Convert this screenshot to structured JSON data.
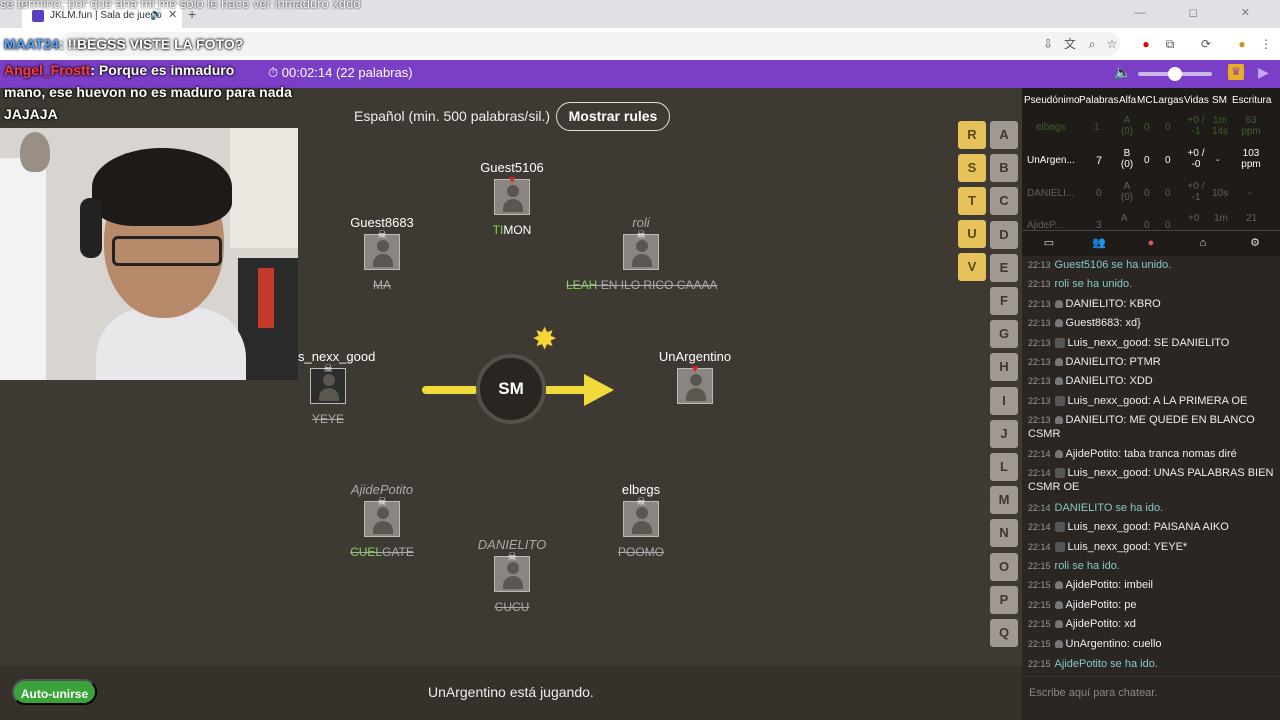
{
  "browser": {
    "tab_title": "JKLM.fun | Sala de juego",
    "controls": "— ◻ ✕"
  },
  "overlay": {
    "top_text": "se termino, por que ana mi me solo le hace ver inmaduro xddd",
    "line1_user": "MAAT24",
    "line1_text": ": !!BEGSS VISTE LA FOTO?",
    "line2_user": "Angel_Frostt",
    "line2_text": ": Porque es inmaduro",
    "line3": "mano, ese huevon no es maduro para nada",
    "line4": "JAJAJA"
  },
  "header": {
    "timer": "⏱ 00:02:14 (22 palabras)"
  },
  "game": {
    "language_label": "Español (min. 500 palabras/sil.)",
    "rules_button": "Mostrar rules",
    "bomb_syllable": "SM",
    "players": [
      {
        "name": "Guest5106",
        "word_green": "TI",
        "word_rest": "MON",
        "status": "alive"
      },
      {
        "name": "Guest8683",
        "word_green": "",
        "word_rest": "MA",
        "status": "dead"
      },
      {
        "name": "roli",
        "word_green": "LEAH",
        "word_rest": " EN ILO RICO CAAAA",
        "status": "dead"
      },
      {
        "name": "Luis_nexx_good",
        "word_green": "",
        "word_rest": "YEYE",
        "status": "dead"
      },
      {
        "name": "UnArgentino",
        "word_green": "",
        "word_rest": "",
        "status": "alive"
      },
      {
        "name": "AjidePotito",
        "word_green": "CUEL",
        "word_rest": "GATE",
        "status": "dead"
      },
      {
        "name": "elbegs",
        "word_green": "",
        "word_rest": "POOMO",
        "status": "dead"
      },
      {
        "name": "DANIELITO",
        "word_green": "",
        "word_rest": "CUCU",
        "status": "dead"
      }
    ],
    "letters_used": [
      "R",
      "S",
      "T",
      "U",
      "V"
    ],
    "letters_open": [
      "A",
      "B",
      "C",
      "D",
      "E",
      "F",
      "G",
      "H",
      "I",
      "J",
      "L",
      "M",
      "N",
      "O",
      "P",
      "Q"
    ],
    "auto_join": "Auto-unirse",
    "status": "UnArgentino está jugando."
  },
  "scoreboard": {
    "headers": [
      "Pseudónimo",
      "Palabras",
      "Alfa",
      "MC",
      "Largas",
      "Vidas",
      "SM",
      "Escritura"
    ],
    "rows": [
      {
        "name": "elbegs",
        "words": "1",
        "alfa": "A (0)",
        "mc": "0",
        "largas": "0",
        "vidas": "+0 / -1",
        "sm": "1m 14s",
        "speed": "63 ppm"
      },
      {
        "name": "UnArgen...",
        "words": "7",
        "alfa": "B (0)",
        "mc": "0",
        "largas": "0",
        "vidas": "+0 / -0",
        "sm": "-",
        "speed": "103 ppm"
      },
      {
        "name": "DANIELI...",
        "words": "0",
        "alfa": "A (0)",
        "mc": "0",
        "largas": "0",
        "vidas": "+0 / -1",
        "sm": "10s",
        "speed": "-"
      },
      {
        "name": "AjideP...",
        "words": "3",
        "alfa": "A",
        "mc": "0",
        "largas": "0",
        "vidas": "+0",
        "sm": "1m",
        "speed": "21"
      }
    ]
  },
  "chat": {
    "messages": [
      {
        "time": "22:13",
        "user": "",
        "text": "Guest5106 se ha unido.",
        "system": true,
        "avatar": false
      },
      {
        "time": "22:13",
        "user": "",
        "text": "roli se ha unido.",
        "system": true,
        "avatar": false
      },
      {
        "time": "22:13",
        "user": "DANIELITO",
        "text": ": KBRO",
        "system": false,
        "avatar": false
      },
      {
        "time": "22:13",
        "user": "Guest8683",
        "text": ": xd}",
        "system": false,
        "avatar": false
      },
      {
        "time": "22:13",
        "user": "Luis_nexx_good",
        "text": ": SE DANIELITO",
        "system": false,
        "avatar": true
      },
      {
        "time": "22:13",
        "user": "DANIELITO",
        "text": ": PTMR",
        "system": false,
        "avatar": false
      },
      {
        "time": "22:13",
        "user": "DANIELITO",
        "text": ": XDD",
        "system": false,
        "avatar": false
      },
      {
        "time": "22:13",
        "user": "Luis_nexx_good",
        "text": ": A LA PRIMERA OE",
        "system": false,
        "avatar": true
      },
      {
        "time": "22:13",
        "user": "DANIELITO",
        "text": ": ME QUEDE EN BLANCO CSMR",
        "system": false,
        "avatar": false
      },
      {
        "time": "22:14",
        "user": "AjidePotito",
        "text": ": taba tranca nomas diré",
        "system": false,
        "avatar": false
      },
      {
        "time": "22:14",
        "user": "Luis_nexx_good",
        "text": ": UNAS PALABRAS BIEN CSMR OE",
        "system": false,
        "avatar": true
      },
      {
        "time": "22:14",
        "user": "",
        "text": "DANIELITO se ha ido.",
        "system": true,
        "avatar": false
      },
      {
        "time": "22:14",
        "user": "Luis_nexx_good",
        "text": ": PAISANA AIKO",
        "system": false,
        "avatar": true
      },
      {
        "time": "22:14",
        "user": "Luis_nexx_good",
        "text": ": YEYE*",
        "system": false,
        "avatar": true
      },
      {
        "time": "22:15",
        "user": "",
        "text": "roli se ha ido.",
        "system": true,
        "avatar": false
      },
      {
        "time": "22:15",
        "user": "AjidePotito",
        "text": ": imbeil",
        "system": false,
        "avatar": false
      },
      {
        "time": "22:15",
        "user": "AjidePotito",
        "text": ": pe",
        "system": false,
        "avatar": false
      },
      {
        "time": "22:15",
        "user": "AjidePotito",
        "text": ": xd",
        "system": false,
        "avatar": false
      },
      {
        "time": "22:15",
        "user": "UnArgentino",
        "text": ": cuello",
        "system": false,
        "avatar": false
      },
      {
        "time": "22:15",
        "user": "",
        "text": "AjidePotito se ha ido.",
        "system": true,
        "avatar": false
      }
    ],
    "input_placeholder": "Escribe aquí para chatear."
  },
  "colors": {
    "accent_purple": "#7a3ec7",
    "used_letter": "#e5c35a",
    "green_text": "#7ed957",
    "auto_join": "#3aa43a"
  }
}
